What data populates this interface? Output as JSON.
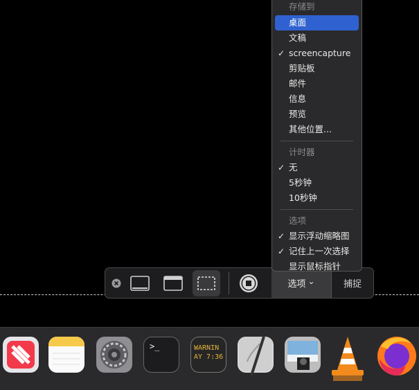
{
  "menu": {
    "save_to_header": "存储到",
    "save_to_items": [
      {
        "label": "桌面",
        "checked": false,
        "highlighted": true
      },
      {
        "label": "文稿",
        "checked": false,
        "highlighted": false
      },
      {
        "label": "screencapture",
        "checked": true,
        "highlighted": false
      },
      {
        "label": "剪贴板",
        "checked": false,
        "highlighted": false
      },
      {
        "label": "邮件",
        "checked": false,
        "highlighted": false
      },
      {
        "label": "信息",
        "checked": false,
        "highlighted": false
      },
      {
        "label": "预览",
        "checked": false,
        "highlighted": false
      },
      {
        "label": "其他位置...",
        "checked": false,
        "highlighted": false
      }
    ],
    "timer_header": "计时器",
    "timer_items": [
      {
        "label": "无",
        "checked": true
      },
      {
        "label": "5秒钟",
        "checked": false
      },
      {
        "label": "10秒钟",
        "checked": false
      }
    ],
    "options_header": "选项",
    "options_items": [
      {
        "label": "显示浮动缩略图",
        "checked": true
      },
      {
        "label": "记住上一次选择",
        "checked": true
      },
      {
        "label": "显示鼠标指针",
        "checked": false
      }
    ],
    "check_mark": "✓"
  },
  "toolbar": {
    "options_label": "选项",
    "options_chevron": "⌄",
    "capture_label": "捕捉",
    "icons": [
      "close-icon",
      "capture-entire-screen-icon",
      "capture-window-icon",
      "capture-selection-icon",
      "record-stop-icon"
    ]
  },
  "dock": {
    "apps": [
      "news-icon",
      "notes-icon",
      "system-preferences-icon",
      "terminal-icon",
      "console-icon",
      "script-editor-icon",
      "preview-icon",
      "vlc-icon",
      "firefox-icon"
    ],
    "console_text": [
      "WARNIN",
      "AY 7:36"
    ],
    "terminal_prompt": ">_"
  },
  "colors": {
    "highlight": "#2f62d0",
    "menu_bg": "#2a2a2c",
    "toolbar_bg": "#1d1d1f"
  }
}
